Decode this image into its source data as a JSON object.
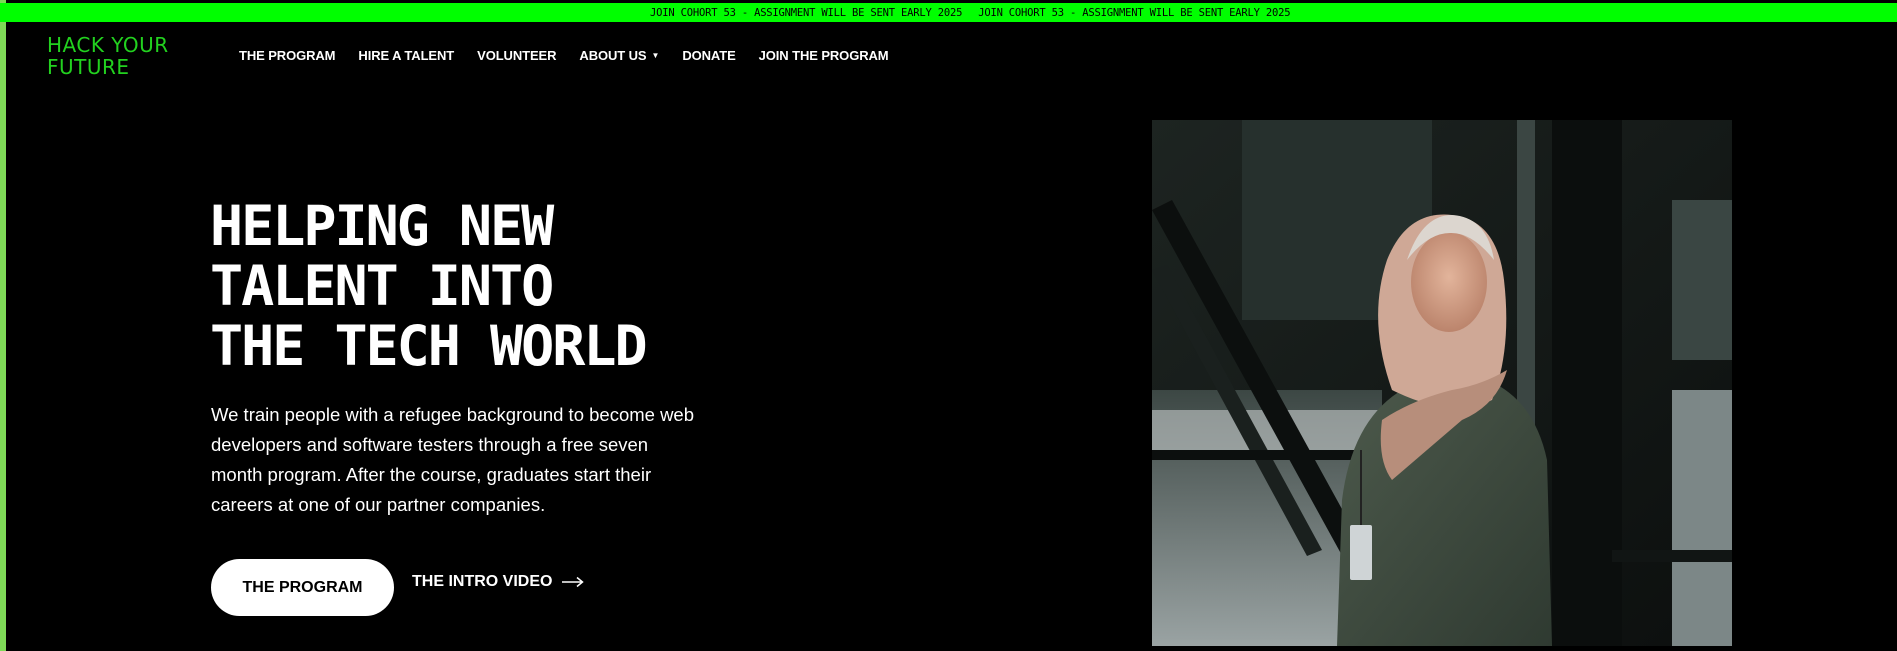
{
  "announcement": {
    "items": [
      "JOIN COHORT 53 - ASSIGNMENT WILL BE SENT EARLY 2025",
      "JOIN COHORT 53 - ASSIGNMENT WILL BE SENT EARLY 2025"
    ]
  },
  "logo": {
    "line1": "HACK YOUR",
    "line2": "FUTURE"
  },
  "nav": {
    "items": [
      {
        "label": "THE PROGRAM"
      },
      {
        "label": "HIRE A TALENT"
      },
      {
        "label": "VOLUNTEER"
      },
      {
        "label": "ABOUT US",
        "has_dropdown": true
      },
      {
        "label": "DONATE"
      },
      {
        "label": "JOIN THE PROGRAM"
      }
    ]
  },
  "hero": {
    "title_lines": [
      "HELPING NEW",
      "TALENT INTO",
      "THE TECH WORLD"
    ],
    "description": "We train people with a refugee background to become web developers and software testers through a free seven month program. After the course, graduates start their careers at one of our partner companies.",
    "primary_button": "THE PROGRAM",
    "secondary_link": "THE INTRO VIDEO"
  },
  "icons": {
    "dropdown": "caret-down-icon",
    "link_arrow": "arrow-right-icon"
  },
  "colors": {
    "accent_green": "#00ff00",
    "logo_green": "#22d11f",
    "background": "#000000",
    "left_rail": "#7ed957"
  }
}
